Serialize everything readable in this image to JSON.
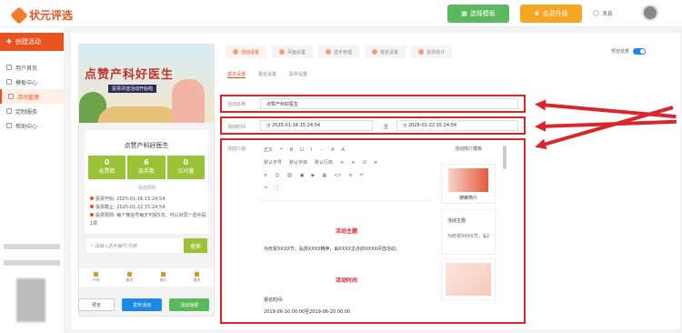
{
  "brand": {
    "name": "状元评选"
  },
  "topbar": {
    "template_button": "选择模板",
    "vip_button": "会员升级",
    "message": "消息"
  },
  "sidebar": {
    "create_button": "创建活动",
    "items": [
      {
        "label": "用户首页"
      },
      {
        "label": "模板中心"
      },
      {
        "label": "活动管理"
      },
      {
        "label": "定制服务"
      },
      {
        "label": "帮助中心"
      }
    ]
  },
  "preview": {
    "poster_title": "点赞产科好医生",
    "poster_sub": "投票评选活动开始啦",
    "activity_name": "点赞产科好医生",
    "stats": [
      {
        "value": "0",
        "label": "总票数"
      },
      {
        "value": "6",
        "label": "选手数"
      },
      {
        "value": "0",
        "label": "访问量"
      }
    ],
    "rules_title": "活动规则",
    "info": [
      "投票开始: 2025-01-16 15:24:54",
      "投票截止: 2025-01-22 15:24:54",
      "投票规则: 每个微信号每天可投5次，可以对同一选手投1票"
    ],
    "search_placeholder": "请输入选手编号/名称",
    "search_button": "搜索",
    "tabs": [
      "介绍",
      "首页",
      "排行",
      "报名"
    ],
    "buttons": {
      "prev": "预览",
      "publish": "发布活动",
      "effect": "活动海报"
    }
  },
  "steps": [
    "活动设置",
    "页面设置",
    "选手管理",
    "报名设置",
    "投票统计"
  ],
  "preview_switch": "预览效果",
  "subtabs": [
    "基本设置",
    "报名设置",
    "投票设置"
  ],
  "form": {
    "name_label": "活动名称",
    "name_value": "点赞产科好医生",
    "time_label": "活动时间",
    "time_start": "2025-01-16 15:24:54",
    "time_sep": "至",
    "time_end": "2025-01-22 15:24:54",
    "intro_label": "活动介绍"
  },
  "editor": {
    "toolbar_row1": [
      "正文",
      "❝",
      "B",
      "U",
      "I",
      "···",
      "A",
      "A"
    ],
    "toolbar_row2": [
      "默认字号",
      "默认字体",
      "默认行高",
      "≡",
      "≡",
      "☑",
      "≡"
    ],
    "toolbar_row3": [
      "≡",
      "☺",
      "⛓",
      "▣",
      "▶",
      "▦",
      "<>",
      "≡",
      "↶"
    ],
    "heading1": "活动主题",
    "body1": "为庆祝XXXX节，弘扬XXXX精神，由XXXX主办的XXXX评选活动。",
    "heading2": "活动时间",
    "body2": "报名时间:",
    "body3": "2019-06-10 00:00至2019-06-20 00:00"
  },
  "templates": {
    "title": "活动简介模板",
    "items": [
      "搜索简介",
      "活动主题",
      "为庆祝XXXX节，弘扬"
    ]
  }
}
